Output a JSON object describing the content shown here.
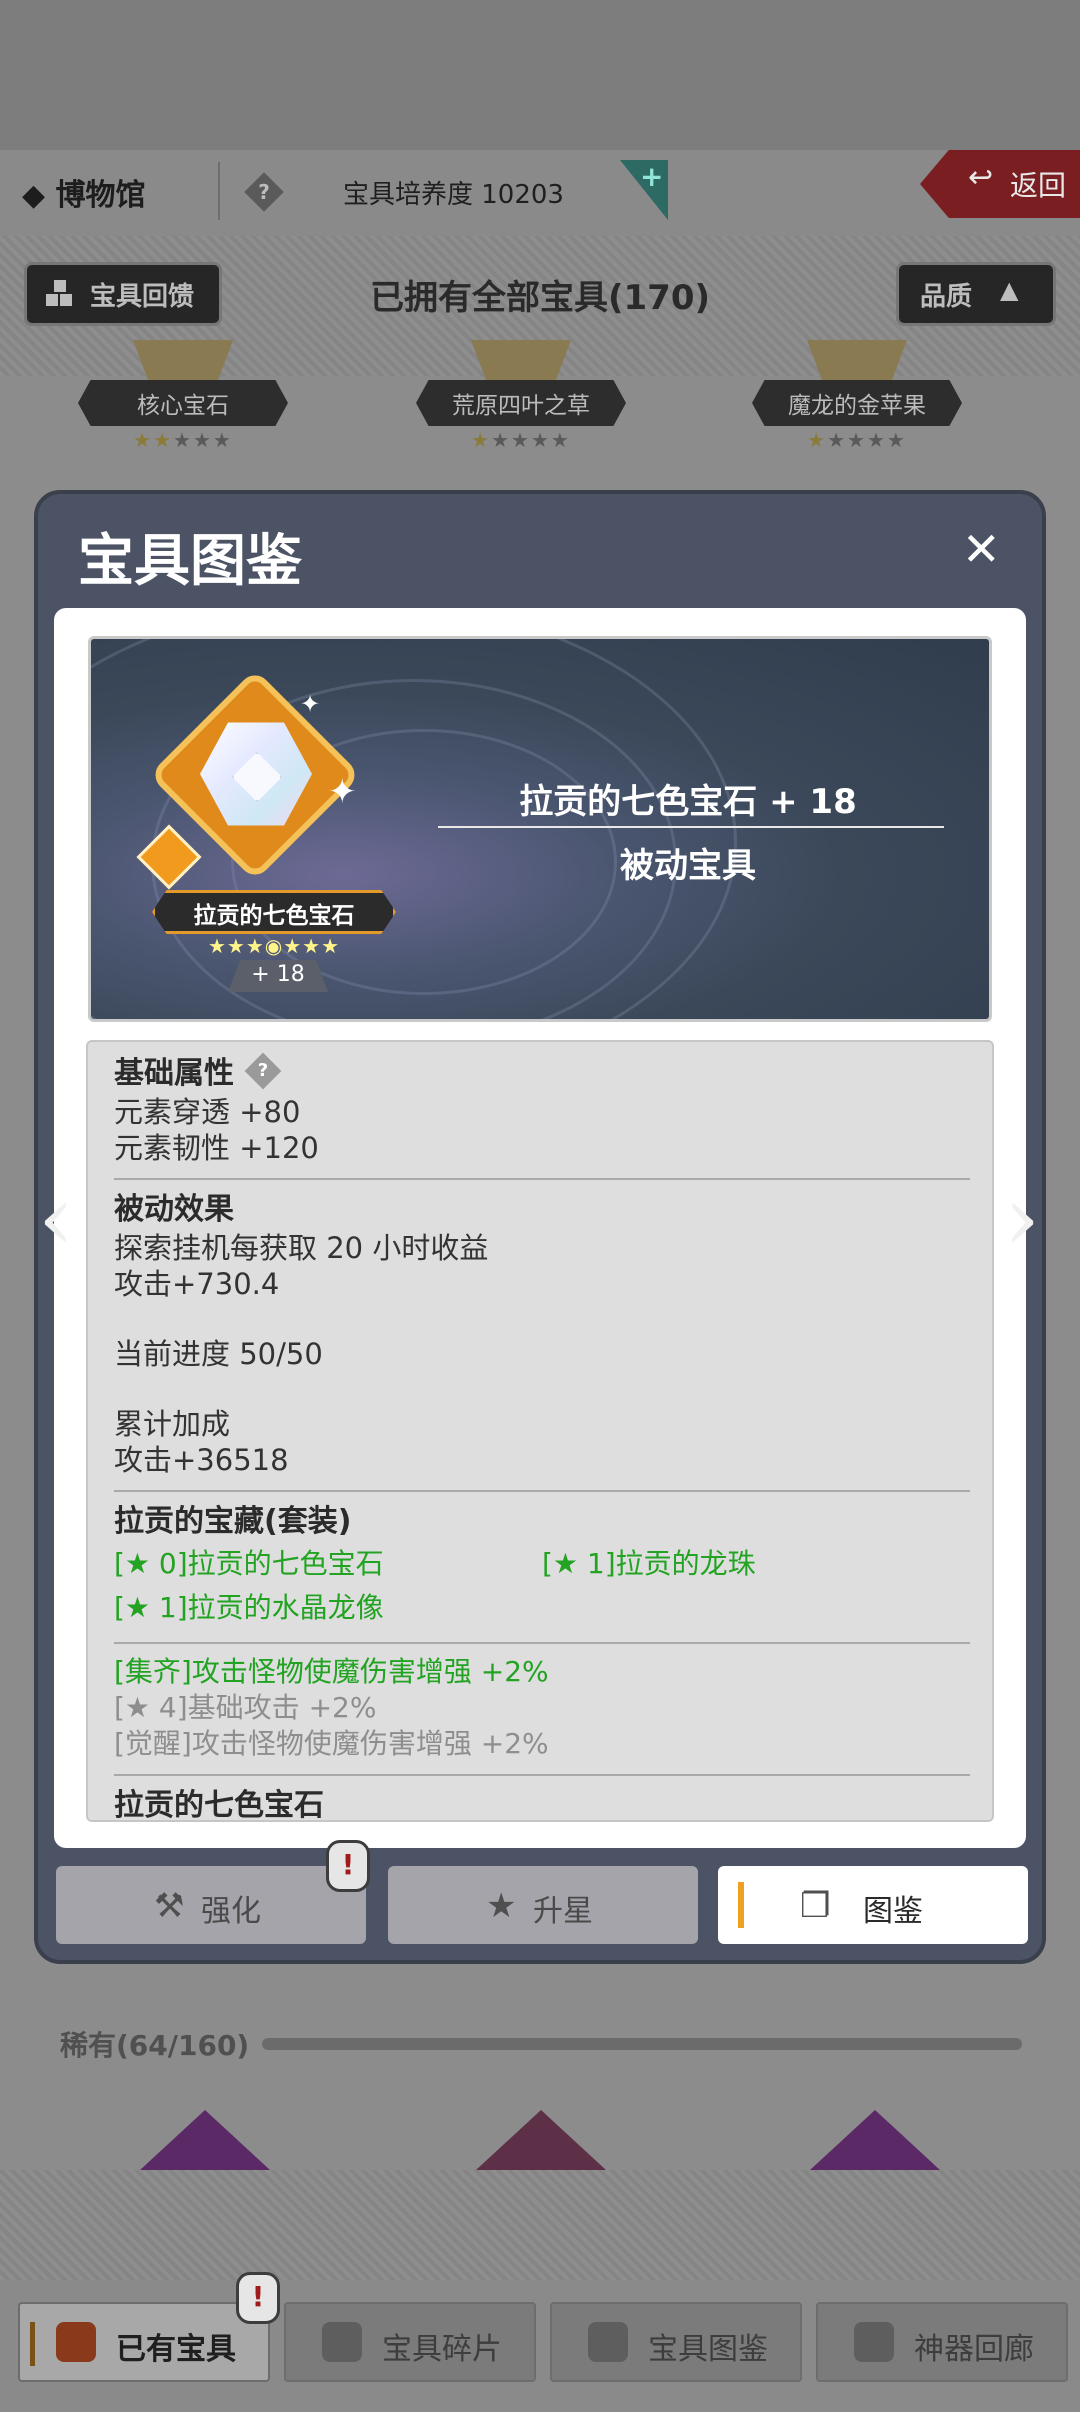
{
  "header": {
    "title": "◆ 博物馆",
    "help_icon": "question-icon",
    "cultivation_text": "宝具培养度 10203",
    "back_label": "返回"
  },
  "toolbar": {
    "feedback_label": "宝具回馈",
    "owned_text": "已拥有全部宝具(170)",
    "quality_label": "品质",
    "quality_arrow": "▲"
  },
  "top_cards": [
    {
      "name": "核心宝石",
      "stars_on": "★★",
      "stars_off": "★★★"
    },
    {
      "name": "荒原四叶之草",
      "stars_on": "★",
      "stars_off": "★★★★"
    },
    {
      "name": "魔龙的金苹果",
      "stars_on": "★",
      "stars_off": "★★★★"
    }
  ],
  "modal": {
    "title": "宝具图鉴",
    "close": "✕",
    "item": {
      "badge_name": "拉贡的七色宝石",
      "stars": "★★★◉★★★",
      "level": "+ 18",
      "name": "拉贡的七色宝石 + 18",
      "type": "被动宝具"
    },
    "desc": {
      "basic_title": "基础属性",
      "basic_lines": [
        "元素穿透 +80",
        "元素韧性 +120"
      ],
      "passive_title": "被动效果",
      "passive_lines": [
        "探索挂机每获取 20 小时收益",
        "攻击+730.4"
      ],
      "progress": "当前进度 50/50",
      "bonus_title": "累计加成",
      "bonus_value": "攻击+36518",
      "set_title": "拉贡的宝藏(套装)",
      "set_items": [
        "[★ 0]拉贡的七色宝石",
        "[★ 1]拉贡的龙珠",
        "[★ 1]拉贡的水晶龙像"
      ],
      "set_effect_active": "[集齐]攻击怪物使魔伤害增强 +2%",
      "set_effect_inactive": [
        "[★ 4]基础攻击 +2%",
        "[觉醒]攻击怪物使魔伤害增强 +2%"
      ],
      "next_title": "拉贡的七色宝石"
    },
    "tabs": [
      {
        "label": "强化",
        "icon": "hammer-icon"
      },
      {
        "label": "升星",
        "icon": "star-icon"
      },
      {
        "label": "图鉴",
        "icon": "cards-icon"
      }
    ]
  },
  "rare": {
    "label": "稀有(64/160)"
  },
  "bottom_tabs": [
    {
      "label": "已有宝具",
      "icon": "chest-icon"
    },
    {
      "label": "宝具碎片",
      "icon": "fragments-icon"
    },
    {
      "label": "宝具图鉴",
      "icon": "scroll-icon"
    },
    {
      "label": "神器回廊",
      "icon": "artifact-icon"
    }
  ],
  "alert_glyph": "!"
}
